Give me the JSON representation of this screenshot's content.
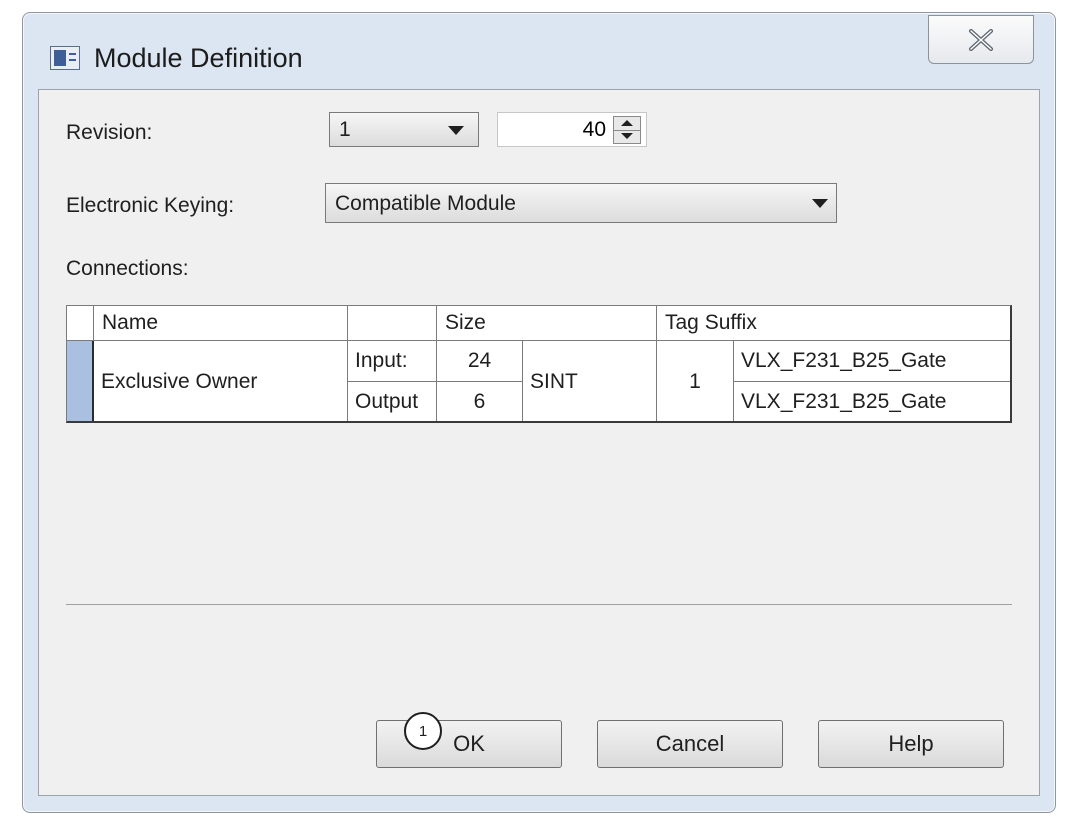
{
  "window": {
    "title": "Module Definition",
    "close_icon": "close-x-icon",
    "app_icon": "module-window-icon"
  },
  "revision": {
    "label": "Revision:",
    "major_value": "1",
    "minor_value": "40"
  },
  "keying": {
    "label": "Electronic Keying:",
    "value": "Compatible Module"
  },
  "connections": {
    "label": "Connections:",
    "headers": {
      "name": "Name",
      "type": "",
      "size": "Size",
      "tag_suffix": "Tag Suffix"
    },
    "row": {
      "name": "Exclusive Owner",
      "input_label": "Input:",
      "output_label": "Output",
      "input_size": "24",
      "output_size": "6",
      "data_type": "SINT",
      "tag_number": "1",
      "input_tag": "VLX_F231_B25_Gate",
      "output_tag": "VLX_F231_B25_Gate"
    }
  },
  "buttons": {
    "ok": "OK",
    "cancel": "Cancel",
    "help": "Help"
  },
  "callout": {
    "number": "1"
  },
  "colors": {
    "frame": "#dce6f2",
    "client": "#f0f0f0",
    "row_selector": "#a9c0e0"
  }
}
